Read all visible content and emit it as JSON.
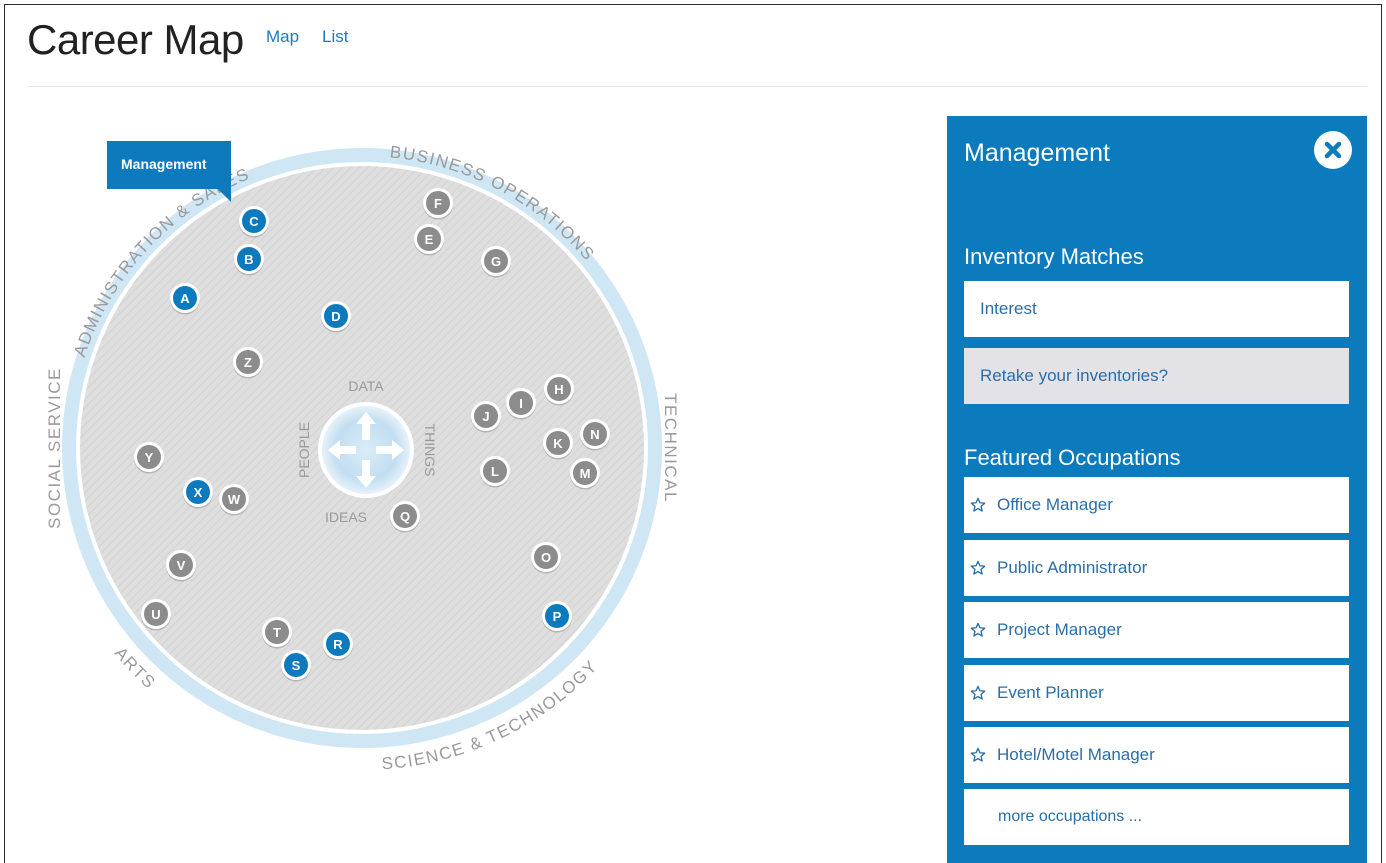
{
  "page": {
    "title": "Career Map"
  },
  "view_links": [
    {
      "label": "Map"
    },
    {
      "label": "List"
    }
  ],
  "career_map": {
    "tooltip": "Management",
    "ring_labels": {
      "admin_sales": "ADMINISTRATION & SALES",
      "business_operations": "BUSINESS OPERATIONS",
      "technical": "TECHNICAL",
      "science_technology": "SCIENCE & TECHNOLOGY",
      "arts": "ARTS",
      "social_service": "SOCIAL SERVICE"
    },
    "center": {
      "top": "DATA",
      "right": "THINGS",
      "bottom": "IDEAS",
      "left": "PEOPLE"
    },
    "colors": {
      "highlight": "#0d7abd",
      "normal": "#8c8c8c",
      "ring": "#cfe6f5"
    },
    "nodes": [
      {
        "letter": "A",
        "highlighted": true
      },
      {
        "letter": "B",
        "highlighted": true
      },
      {
        "letter": "C",
        "highlighted": true
      },
      {
        "letter": "D",
        "highlighted": true
      },
      {
        "letter": "E",
        "highlighted": false
      },
      {
        "letter": "F",
        "highlighted": false
      },
      {
        "letter": "G",
        "highlighted": false
      },
      {
        "letter": "H",
        "highlighted": false
      },
      {
        "letter": "I",
        "highlighted": false
      },
      {
        "letter": "J",
        "highlighted": false
      },
      {
        "letter": "K",
        "highlighted": false
      },
      {
        "letter": "L",
        "highlighted": false
      },
      {
        "letter": "M",
        "highlighted": false
      },
      {
        "letter": "N",
        "highlighted": false
      },
      {
        "letter": "O",
        "highlighted": false
      },
      {
        "letter": "P",
        "highlighted": true
      },
      {
        "letter": "Q",
        "highlighted": false
      },
      {
        "letter": "R",
        "highlighted": true
      },
      {
        "letter": "S",
        "highlighted": true
      },
      {
        "letter": "T",
        "highlighted": false
      },
      {
        "letter": "U",
        "highlighted": false
      },
      {
        "letter": "V",
        "highlighted": false
      },
      {
        "letter": "W",
        "highlighted": false
      },
      {
        "letter": "X",
        "highlighted": true
      },
      {
        "letter": "Y",
        "highlighted": false
      },
      {
        "letter": "Z",
        "highlighted": false
      }
    ]
  },
  "panel": {
    "title": "Management",
    "close_icon": "close-icon",
    "inventory_heading": "Inventory Matches",
    "inventory_items": [
      "Interest"
    ],
    "retake_label": "Retake your inventories?",
    "featured_heading": "Featured Occupations",
    "occupations": [
      "Office Manager",
      "Public Administrator",
      "Project Manager",
      "Event Planner",
      "Hotel/Motel Manager"
    ],
    "star_icon": "star-outline-icon",
    "more_label": "more occupations ..."
  }
}
